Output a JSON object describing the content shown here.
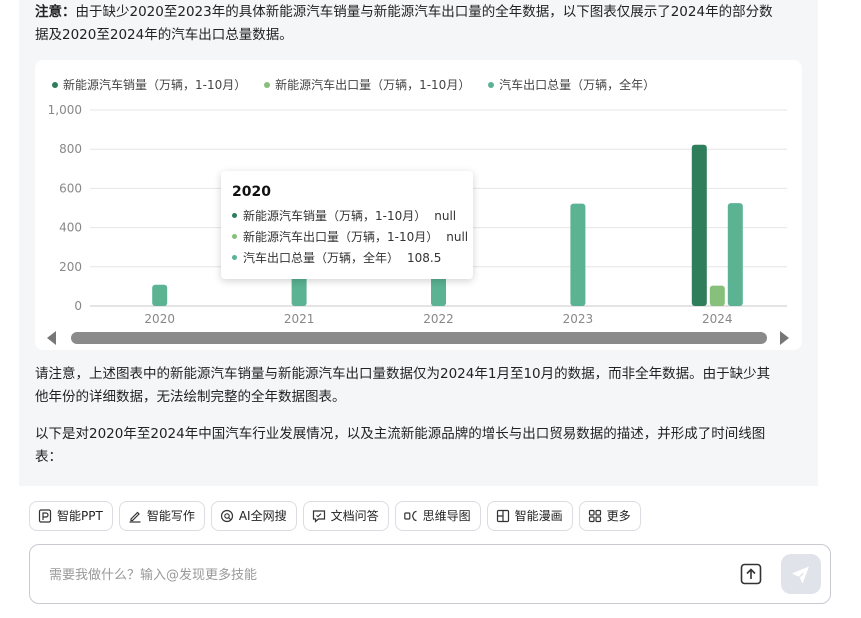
{
  "message": {
    "note_label": "注意：",
    "note_line1": "由于缺少2020至2023年的具体新能源汽车销量与新能源汽车出口量的全年数据，以下图表仅展示了2024年的部分数",
    "note_line2": "据及2020至2024年的汽车出口总量数据。",
    "after_chart_line1": "请注意，上述图表中的新能源汽车销量与新能源汽车出口量数据仅为2024年1月至10月的数据，而非全年数据。由于缺少其",
    "after_chart_line2": "他年份的详细数据，无法绘制完整的全年数据图表。",
    "intro_line1": "以下是对2020年至2024年中国汽车行业发展情况，以及主流新能源品牌的增长与出口贸易数据的描述，并形成了时间线图",
    "intro_line2": "表："
  },
  "chart_data": {
    "type": "bar",
    "categories": [
      "2020",
      "2021",
      "2022",
      "2023",
      "2024"
    ],
    "series": [
      {
        "name": "新能源汽车销量（万辆，1-10月）",
        "values": [
          null,
          null,
          null,
          null,
          823
        ],
        "color": "#2e7d5b"
      },
      {
        "name": "新能源汽车出口量（万辆，1-10月）",
        "values": [
          null,
          null,
          null,
          null,
          104
        ],
        "color": "#86c07a"
      },
      {
        "name": "汽车出口总量（万辆，全年）",
        "values": [
          108.5,
          201.5,
          311.1,
          522.1,
          525
        ],
        "color": "#5bb394"
      }
    ],
    "ylim": [
      0,
      1000
    ],
    "yticks": [
      "1,000",
      "800",
      "600",
      "400",
      "200",
      "0"
    ],
    "grid": true,
    "legend_position": "top-left"
  },
  "tooltip": {
    "title": "2020",
    "rows": [
      {
        "label": "新能源汽车销量（万辆，1-10月）",
        "value": "null"
      },
      {
        "label": "新能源汽车出口量（万辆，1-10月）",
        "value": "null"
      },
      {
        "label": "汽车出口总量（万辆，全年）",
        "value": "108.5"
      }
    ]
  },
  "toolbar": {
    "items": [
      {
        "label": "智能PPT",
        "icon": "ppt-icon"
      },
      {
        "label": "智能写作",
        "icon": "pen-icon"
      },
      {
        "label": "AI全网搜",
        "icon": "search-icon"
      },
      {
        "label": "文档问答",
        "icon": "chat-icon"
      },
      {
        "label": "思维导图",
        "icon": "mindmap-icon"
      },
      {
        "label": "智能漫画",
        "icon": "comic-icon"
      },
      {
        "label": "更多",
        "icon": "grid-icon"
      }
    ]
  },
  "input": {
    "placeholder": "需要我做什么？输入@发现更多技能",
    "value": ""
  }
}
